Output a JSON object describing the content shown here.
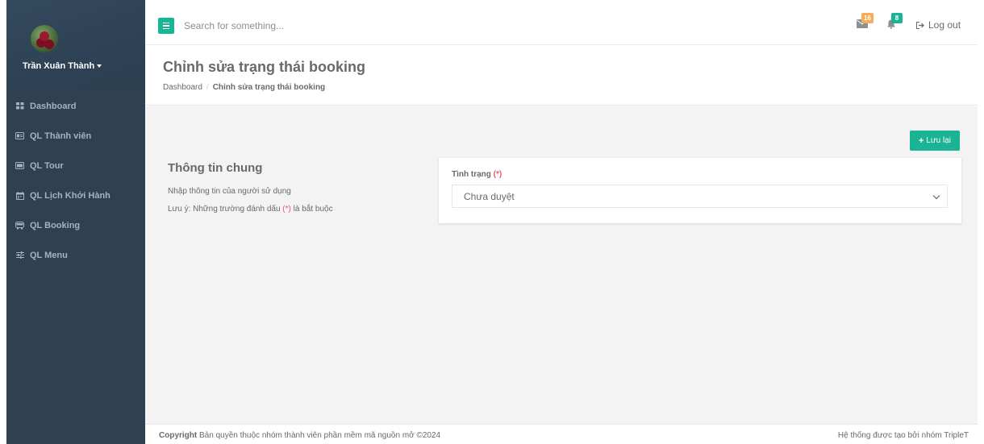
{
  "sidebar": {
    "user_name": "Trần Xuân Thành",
    "items": [
      {
        "label": "Dashboard",
        "icon": "grid-icon"
      },
      {
        "label": "QL Thành viên",
        "icon": "id-card-icon"
      },
      {
        "label": "QL Tour",
        "icon": "ticket-icon"
      },
      {
        "label": "QL Lịch Khởi Hành",
        "icon": "calendar-icon"
      },
      {
        "label": "QL Booking",
        "icon": "bus-icon"
      },
      {
        "label": "QL Menu",
        "icon": "sliders-icon"
      }
    ]
  },
  "topbar": {
    "search_placeholder": "Search for something...",
    "messages_count": "16",
    "notifications_count": "8",
    "logout_label": "Log out"
  },
  "heading": {
    "title": "Chỉnh sửa trạng thái booking",
    "breadcrumb_home": "Dashboard",
    "breadcrumb_current": "Chỉnh sửa trạng thái booking"
  },
  "form": {
    "save_label": "Lưu lại",
    "section_title": "Thông tin chung",
    "section_desc": "Nhập thông tin của người sử dụng",
    "note_prefix": "Lưu ý: Những trường đánh dấu",
    "note_required_mark": "(*)",
    "note_suffix": "là bắt buộc",
    "status_label": "Tình trạng",
    "required_mark": "(*)",
    "status_value": "Chưa duyệt"
  },
  "footer": {
    "copyright_bold": "Copyright",
    "copyright_text": "Bản quyền thuộc nhóm thành viên phần mềm mã nguồn mở ©2024",
    "right_text": "Hệ thống được tạo bởi nhóm TripleT"
  },
  "colors": {
    "sidebar_bg": "#2f4050",
    "accent": "#1ab394",
    "badge_warning": "#f8ac59",
    "required": "#ed5565",
    "content_bg": "#f3f3f4"
  }
}
